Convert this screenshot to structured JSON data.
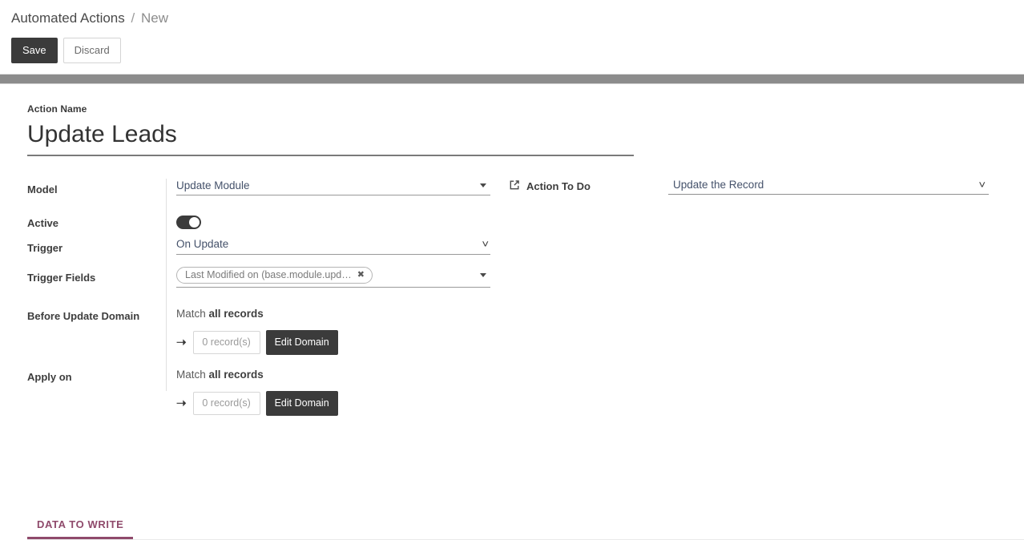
{
  "breadcrumb": {
    "parent": "Automated Actions",
    "separator": "/",
    "current": "New"
  },
  "toolbar": {
    "save_label": "Save",
    "discard_label": "Discard"
  },
  "form": {
    "action_name_label": "Action Name",
    "action_name_value": "Update Leads",
    "model": {
      "label": "Model",
      "value": "Update Module"
    },
    "action_to_do": {
      "label": "Action To Do",
      "icon": "external-link-icon",
      "value": "Update the Record"
    },
    "active": {
      "label": "Active",
      "state": "on"
    },
    "trigger": {
      "label": "Trigger",
      "value": "On Update"
    },
    "trigger_fields": {
      "label": "Trigger Fields",
      "tags": [
        {
          "text": "Last Modified on (base.module.upd…",
          "remove_icon": "close-icon"
        }
      ]
    },
    "before_update_domain": {
      "label": "Before Update Domain",
      "match_prefix": "Match",
      "match_target": "all records",
      "arrow_icon": "arrow-right-icon",
      "record_count": "0 record(s)",
      "edit_button": "Edit Domain"
    },
    "apply_on": {
      "label": "Apply on",
      "match_prefix": "Match",
      "match_target": "all records",
      "arrow_icon": "arrow-right-icon",
      "record_count": "0 record(s)",
      "edit_button": "Edit Domain"
    }
  },
  "notebook": {
    "tabs": [
      {
        "label": "DATA TO WRITE",
        "active": true
      }
    ]
  },
  "colors": {
    "accent_tab": "#8f4a6b",
    "button_dark": "#3b3b3b",
    "separator_bar": "#8c8c8c"
  }
}
